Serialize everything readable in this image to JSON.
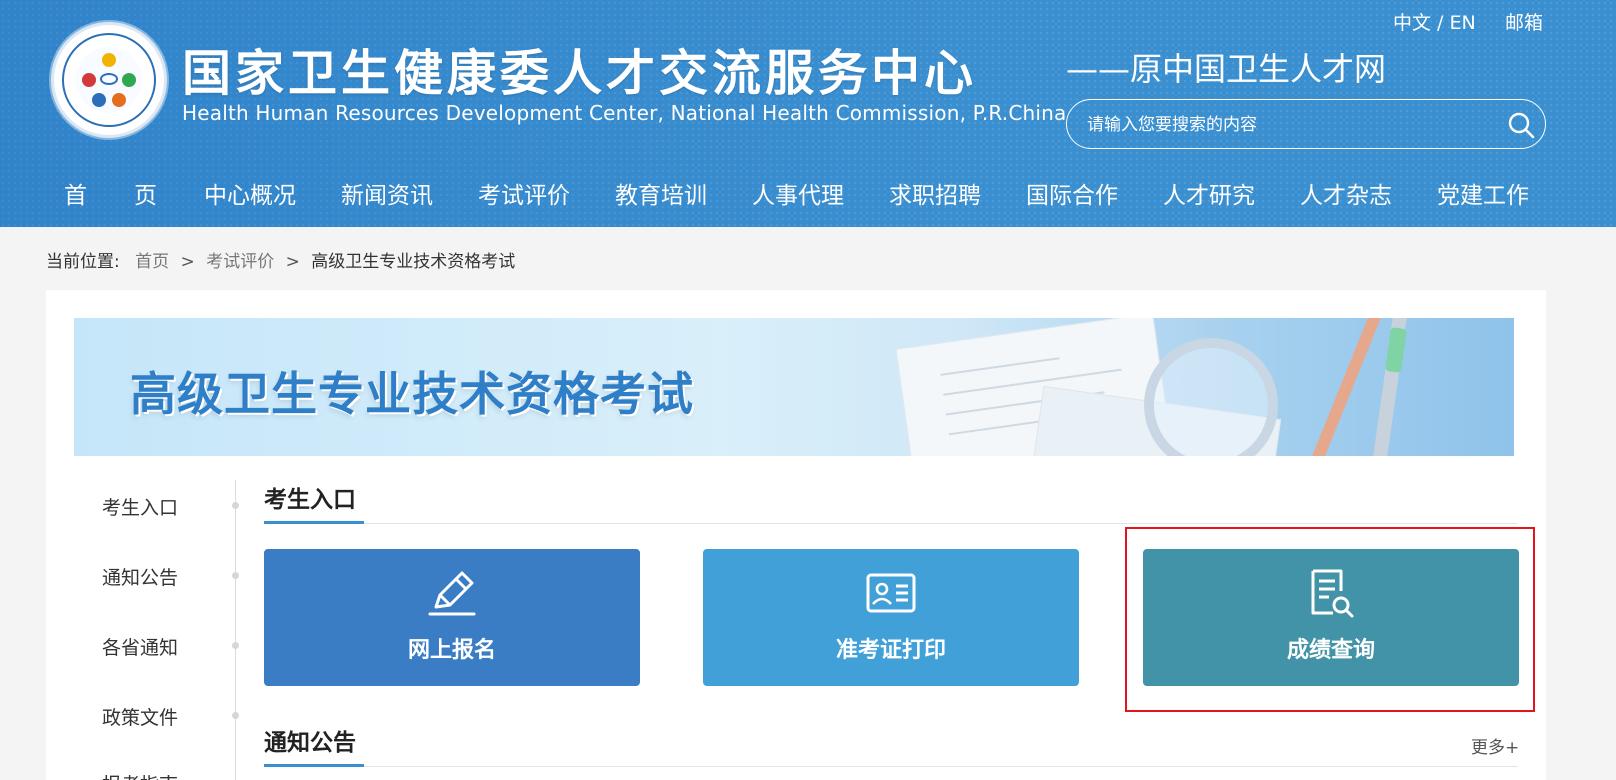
{
  "header": {
    "title": "国家卫生健康委人才交流服务中心",
    "subtitle": "Health Human Resources Development Center, National Health Commission, P.R.China",
    "tagline": "——原中国卫生人才网",
    "lang": "中文 / EN",
    "mail": "邮箱",
    "search_placeholder": "请输入您要搜索的内容"
  },
  "nav": [
    "首",
    "页",
    "中心概况",
    "新闻资讯",
    "考试评价",
    "教育培训",
    "人事代理",
    "求职招聘",
    "国际合作",
    "人才研究",
    "人才杂志",
    "党建工作"
  ],
  "breadcrumb": {
    "label": "当前位置:",
    "home": "首页",
    "sep": ">",
    "section": "考试评价",
    "current": "高级卫生专业技术资格考试"
  },
  "banner": {
    "title": "高级卫生专业技术资格考试"
  },
  "sidebar": [
    "考生入口",
    "通知公告",
    "各省通知",
    "政策文件",
    "报考指南"
  ],
  "section_entry": {
    "title": "考生入口"
  },
  "tiles": [
    {
      "label": "网上报名",
      "color": "#3a7dc5",
      "icon": "pencil-icon"
    },
    {
      "label": "准考证打印",
      "color": "#42a0d9",
      "icon": "id-card-icon"
    },
    {
      "label": "成绩查询",
      "color": "#4293a8",
      "icon": "document-search-icon"
    }
  ],
  "section_notice": {
    "title": "通知公告",
    "more": "更多+"
  },
  "colors": {
    "header_bg": "#3a8fd0",
    "accent": "#3a8fd0",
    "highlight": "#e3151c"
  }
}
